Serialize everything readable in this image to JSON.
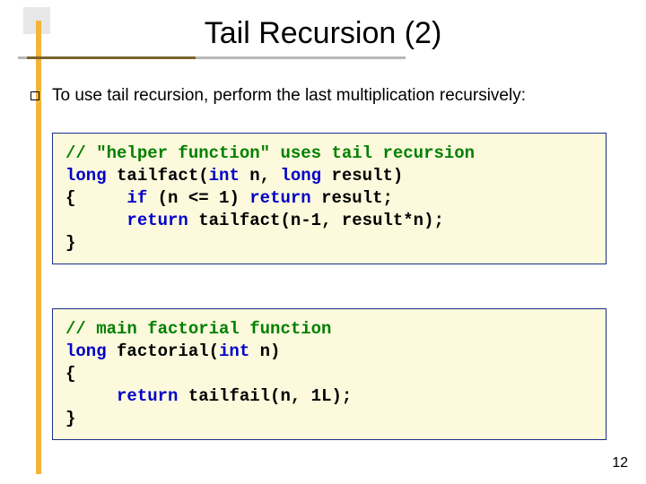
{
  "title": "Tail Recursion (2)",
  "bullet": "To use tail recursion, perform the last multiplication recursively:",
  "code1": {
    "c1": "// \"helper function\" uses tail recursion",
    "kw_long1": "long",
    "l2a": " tailfact(",
    "kw_int1": "int",
    "l2b": " n, ",
    "kw_long2": "long",
    "l2c": " result)",
    "l3a": "{     ",
    "kw_if": "if",
    "l3b": " (n <= 1) ",
    "kw_ret1": "return",
    "l3c": " result;",
    "l4a": "      ",
    "kw_ret2": "return",
    "l4b": " tailfact(n-1, result*n);",
    "l5": "}"
  },
  "code2": {
    "c1": "// main factorial function",
    "kw_long1": "long",
    "l2a": " factorial(",
    "kw_int1": "int",
    "l2b": " n)",
    "l3": "{",
    "l4a": "     ",
    "kw_ret1": "return",
    "l4b": " tailfail(n, 1L);",
    "l5": "}"
  },
  "page_number": "12"
}
